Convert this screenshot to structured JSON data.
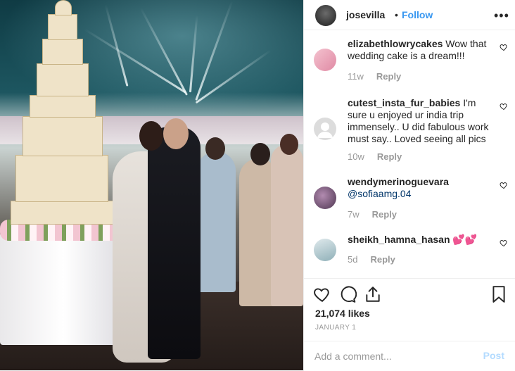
{
  "header": {
    "username": "josevilla",
    "separator": "•",
    "follow_label": "Follow",
    "more_label": "•••"
  },
  "comments": [
    {
      "username": "elizabethlowrycakes",
      "text": "Wow that wedding cake is a dream!!!",
      "age": "11w",
      "reply_label": "Reply",
      "avatar_color": "#e7a6b8"
    },
    {
      "username": "cutest_insta_fur_babies",
      "text": "I'm sure u enjoyed ur india trip immensely.. U did fabulous work must say.. Loved seeing all pics",
      "age": "10w",
      "reply_label": "Reply",
      "avatar_color": "#d8d8d8"
    },
    {
      "username": "wendymerinoguevara",
      "text": "@sofiaamg.04",
      "age": "7w",
      "reply_label": "Reply",
      "avatar_color": "#7b5a78"
    },
    {
      "username": "sheikh_hamna_hasan",
      "text": "💕💕",
      "age": "5d",
      "reply_label": "Reply",
      "avatar_color": "#a9c3c9"
    }
  ],
  "actions": {
    "like_icon": "heart-icon",
    "comment_icon": "comment-bubble-icon",
    "share_icon": "share-icon",
    "save_icon": "bookmark-icon"
  },
  "likes": "21,074 likes",
  "date": "JANUARY 1",
  "add_comment": {
    "placeholder": "Add a comment...",
    "post_label": "Post"
  },
  "colors": {
    "link_blue": "#3897f0",
    "post_disabled": "#b3dbff",
    "meta_gray": "#999999"
  }
}
